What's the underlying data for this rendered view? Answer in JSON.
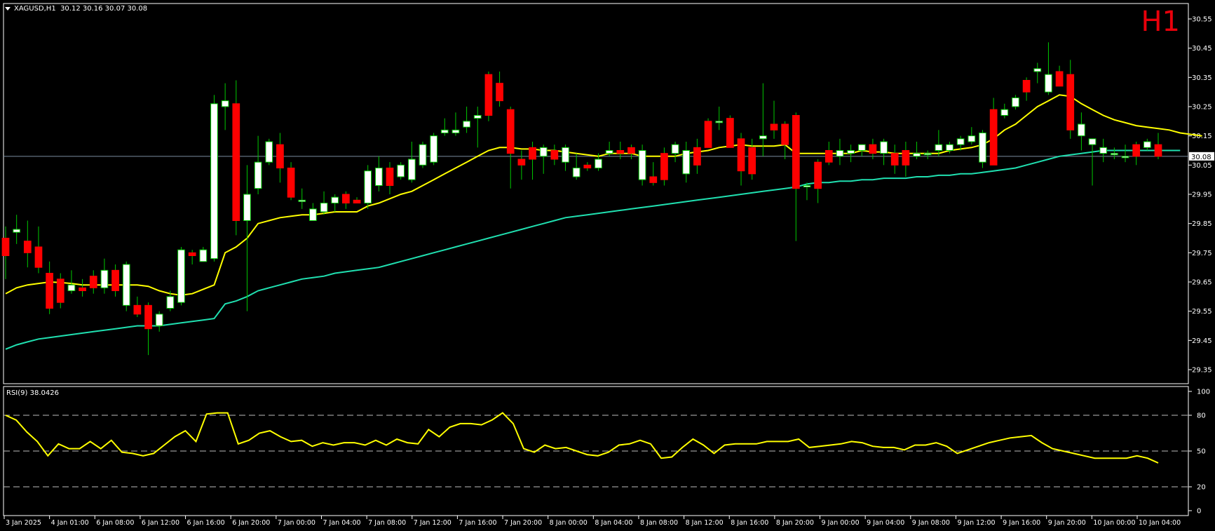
{
  "header": {
    "symbol": "XAGUSD,H1",
    "ohlc": "30.12 30.16 30.07 30.08"
  },
  "timeframe_badge": "H1",
  "current_price_label": "30.08",
  "rsi": {
    "label": "RSI(9) 38.0426"
  },
  "colors": {
    "background": "#000000",
    "bull_candle": "#ffffff",
    "bear_candle": "#ff0000",
    "wick": "#00c800",
    "ma_fast": "#ffff00",
    "ma_slow": "#20e0b0",
    "rsi_line": "#ffff00",
    "bid_line": "#7a8ca0",
    "grid_text": "#ffffff",
    "badge": "#e8000b"
  },
  "chart_data": [
    {
      "type": "candlestick",
      "symbol": "XAGUSD",
      "timeframe": "H1",
      "ylim": [
        29.3,
        30.6
      ],
      "y_ticks": [
        "30.55",
        "30.45",
        "30.35",
        "30.25",
        "30.15",
        "30.05",
        "29.95",
        "29.85",
        "29.75",
        "29.65",
        "29.55",
        "29.45",
        "29.35"
      ],
      "x_tick_labels": [
        "3 Jan 2025",
        "4 Jan 01:00",
        "6 Jan 08:00",
        "6 Jan 12:00",
        "6 Jan 16:00",
        "6 Jan 20:00",
        "7 Jan 00:00",
        "7 Jan 04:00",
        "7 Jan 08:00",
        "7 Jan 12:00",
        "7 Jan 16:00",
        "7 Jan 20:00",
        "8 Jan 00:00",
        "8 Jan 04:00",
        "8 Jan 08:00",
        "8 Jan 12:00",
        "8 Jan 16:00",
        "8 Jan 20:00",
        "9 Jan 00:00",
        "9 Jan 04:00",
        "9 Jan 08:00",
        "9 Jan 12:00",
        "9 Jan 16:00",
        "9 Jan 20:00",
        "10 Jan 00:00",
        "10 Jan 04:00"
      ],
      "candles": [
        {
          "o": 29.8,
          "h": 29.84,
          "l": 29.66,
          "c": 29.74
        },
        {
          "o": 29.82,
          "h": 29.88,
          "l": 29.78,
          "c": 29.83
        },
        {
          "o": 29.79,
          "h": 29.86,
          "l": 29.7,
          "c": 29.75
        },
        {
          "o": 29.77,
          "h": 29.84,
          "l": 29.68,
          "c": 29.7
        },
        {
          "o": 29.68,
          "h": 29.72,
          "l": 29.54,
          "c": 29.56
        },
        {
          "o": 29.66,
          "h": 29.68,
          "l": 29.56,
          "c": 29.58
        },
        {
          "o": 29.62,
          "h": 29.69,
          "l": 29.61,
          "c": 29.64
        },
        {
          "o": 29.63,
          "h": 29.66,
          "l": 29.6,
          "c": 29.62
        },
        {
          "o": 29.67,
          "h": 29.69,
          "l": 29.61,
          "c": 29.63
        },
        {
          "o": 29.63,
          "h": 29.73,
          "l": 29.61,
          "c": 29.69
        },
        {
          "o": 29.69,
          "h": 29.71,
          "l": 29.6,
          "c": 29.62
        },
        {
          "o": 29.57,
          "h": 29.72,
          "l": 29.55,
          "c": 29.71
        },
        {
          "o": 29.57,
          "h": 29.6,
          "l": 29.53,
          "c": 29.54
        },
        {
          "o": 29.57,
          "h": 29.58,
          "l": 29.4,
          "c": 29.49
        },
        {
          "o": 29.5,
          "h": 29.55,
          "l": 29.48,
          "c": 29.54
        },
        {
          "o": 29.56,
          "h": 29.62,
          "l": 29.55,
          "c": 29.6
        },
        {
          "o": 29.58,
          "h": 29.77,
          "l": 29.57,
          "c": 29.76
        },
        {
          "o": 29.75,
          "h": 29.76,
          "l": 29.71,
          "c": 29.74
        },
        {
          "o": 29.72,
          "h": 29.77,
          "l": 29.72,
          "c": 29.76
        },
        {
          "o": 29.73,
          "h": 30.29,
          "l": 29.72,
          "c": 30.26
        },
        {
          "o": 30.25,
          "h": 30.33,
          "l": 30.17,
          "c": 30.27
        },
        {
          "o": 30.26,
          "h": 30.34,
          "l": 29.81,
          "c": 29.86
        },
        {
          "o": 29.86,
          "h": 30.05,
          "l": 29.55,
          "c": 29.95
        },
        {
          "o": 29.97,
          "h": 30.15,
          "l": 29.95,
          "c": 30.06
        },
        {
          "o": 30.06,
          "h": 30.14,
          "l": 30.05,
          "c": 30.13
        },
        {
          "o": 30.12,
          "h": 30.16,
          "l": 29.99,
          "c": 30.04
        },
        {
          "o": 30.04,
          "h": 30.06,
          "l": 29.93,
          "c": 29.94
        },
        {
          "o": 29.93,
          "h": 29.97,
          "l": 29.9,
          "c": 29.93
        },
        {
          "o": 29.86,
          "h": 29.92,
          "l": 29.86,
          "c": 29.9
        },
        {
          "o": 29.89,
          "h": 29.96,
          "l": 29.88,
          "c": 29.92
        },
        {
          "o": 29.92,
          "h": 29.95,
          "l": 29.89,
          "c": 29.94
        },
        {
          "o": 29.95,
          "h": 29.96,
          "l": 29.9,
          "c": 29.92
        },
        {
          "o": 29.93,
          "h": 29.94,
          "l": 29.92,
          "c": 29.92
        },
        {
          "o": 29.92,
          "h": 30.05,
          "l": 29.9,
          "c": 30.03
        },
        {
          "o": 29.98,
          "h": 30.08,
          "l": 29.96,
          "c": 30.04
        },
        {
          "o": 30.04,
          "h": 30.06,
          "l": 29.95,
          "c": 29.98
        },
        {
          "o": 30.01,
          "h": 30.06,
          "l": 30.0,
          "c": 30.05
        },
        {
          "o": 30.0,
          "h": 30.13,
          "l": 29.99,
          "c": 30.07
        },
        {
          "o": 30.05,
          "h": 30.13,
          "l": 30.04,
          "c": 30.12
        },
        {
          "o": 30.06,
          "h": 30.16,
          "l": 30.05,
          "c": 30.15
        },
        {
          "o": 30.16,
          "h": 30.21,
          "l": 30.15,
          "c": 30.17
        },
        {
          "o": 30.16,
          "h": 30.23,
          "l": 30.15,
          "c": 30.17
        },
        {
          "o": 30.18,
          "h": 30.25,
          "l": 30.16,
          "c": 30.2
        },
        {
          "o": 30.21,
          "h": 30.25,
          "l": 30.11,
          "c": 30.22
        },
        {
          "o": 30.36,
          "h": 30.37,
          "l": 30.2,
          "c": 30.22
        },
        {
          "o": 30.33,
          "h": 30.37,
          "l": 30.25,
          "c": 30.27
        },
        {
          "o": 30.24,
          "h": 30.25,
          "l": 29.97,
          "c": 30.09
        },
        {
          "o": 30.07,
          "h": 30.1,
          "l": 30.0,
          "c": 30.05
        },
        {
          "o": 30.11,
          "h": 30.13,
          "l": 30.0,
          "c": 30.07
        },
        {
          "o": 30.08,
          "h": 30.12,
          "l": 30.02,
          "c": 30.11
        },
        {
          "o": 30.1,
          "h": 30.12,
          "l": 30.05,
          "c": 30.07
        },
        {
          "o": 30.06,
          "h": 30.12,
          "l": 30.03,
          "c": 30.11
        },
        {
          "o": 30.01,
          "h": 30.09,
          "l": 30.0,
          "c": 30.04
        },
        {
          "o": 30.05,
          "h": 30.06,
          "l": 30.03,
          "c": 30.04
        },
        {
          "o": 30.04,
          "h": 30.09,
          "l": 30.03,
          "c": 30.07
        },
        {
          "o": 30.09,
          "h": 30.13,
          "l": 30.08,
          "c": 30.1
        },
        {
          "o": 30.1,
          "h": 30.13,
          "l": 30.07,
          "c": 30.09
        },
        {
          "o": 30.11,
          "h": 30.12,
          "l": 30.07,
          "c": 30.09
        },
        {
          "o": 30.0,
          "h": 30.12,
          "l": 29.98,
          "c": 30.1
        },
        {
          "o": 30.01,
          "h": 30.06,
          "l": 29.98,
          "c": 29.99
        },
        {
          "o": 30.09,
          "h": 30.11,
          "l": 29.98,
          "c": 30.0
        },
        {
          "o": 30.09,
          "h": 30.13,
          "l": 30.06,
          "c": 30.12
        },
        {
          "o": 30.02,
          "h": 30.13,
          "l": 29.99,
          "c": 30.1
        },
        {
          "o": 30.11,
          "h": 30.14,
          "l": 30.02,
          "c": 30.05
        },
        {
          "o": 30.2,
          "h": 30.21,
          "l": 30.11,
          "c": 30.11
        },
        {
          "o": 30.2,
          "h": 30.25,
          "l": 30.17,
          "c": 30.2
        },
        {
          "o": 30.21,
          "h": 30.22,
          "l": 30.13,
          "c": 30.11
        },
        {
          "o": 30.14,
          "h": 30.16,
          "l": 29.98,
          "c": 30.03
        },
        {
          "o": 30.11,
          "h": 30.14,
          "l": 30.0,
          "c": 30.02
        },
        {
          "o": 30.14,
          "h": 30.33,
          "l": 30.08,
          "c": 30.15
        },
        {
          "o": 30.19,
          "h": 30.27,
          "l": 30.14,
          "c": 30.17
        },
        {
          "o": 30.19,
          "h": 30.2,
          "l": 30.07,
          "c": 30.12
        },
        {
          "o": 30.22,
          "h": 30.23,
          "l": 29.79,
          "c": 29.97
        },
        {
          "o": 29.98,
          "h": 29.99,
          "l": 29.93,
          "c": 29.98
        },
        {
          "o": 30.06,
          "h": 30.07,
          "l": 29.92,
          "c": 29.97
        },
        {
          "o": 30.1,
          "h": 30.13,
          "l": 30.05,
          "c": 30.06
        },
        {
          "o": 30.08,
          "h": 30.14,
          "l": 30.05,
          "c": 30.1
        },
        {
          "o": 30.09,
          "h": 30.12,
          "l": 30.06,
          "c": 30.1
        },
        {
          "o": 30.1,
          "h": 30.12,
          "l": 30.08,
          "c": 30.12
        },
        {
          "o": 30.12,
          "h": 30.14,
          "l": 30.07,
          "c": 30.09
        },
        {
          "o": 30.09,
          "h": 30.14,
          "l": 30.05,
          "c": 30.13
        },
        {
          "o": 30.09,
          "h": 30.12,
          "l": 30.02,
          "c": 30.05
        },
        {
          "o": 30.1,
          "h": 30.13,
          "l": 30.01,
          "c": 30.05
        },
        {
          "o": 30.08,
          "h": 30.13,
          "l": 30.07,
          "c": 30.09
        },
        {
          "o": 30.09,
          "h": 30.1,
          "l": 30.07,
          "c": 30.09
        },
        {
          "o": 30.1,
          "h": 30.17,
          "l": 30.08,
          "c": 30.12
        },
        {
          "o": 30.1,
          "h": 30.13,
          "l": 30.09,
          "c": 30.12
        },
        {
          "o": 30.12,
          "h": 30.15,
          "l": 30.1,
          "c": 30.14
        },
        {
          "o": 30.13,
          "h": 30.18,
          "l": 30.12,
          "c": 30.15
        },
        {
          "o": 30.06,
          "h": 30.17,
          "l": 30.04,
          "c": 30.16
        },
        {
          "o": 30.24,
          "h": 30.28,
          "l": 30.05,
          "c": 30.05
        },
        {
          "o": 30.22,
          "h": 30.26,
          "l": 30.21,
          "c": 30.24
        },
        {
          "o": 30.25,
          "h": 30.29,
          "l": 30.24,
          "c": 30.28
        },
        {
          "o": 30.34,
          "h": 30.35,
          "l": 30.27,
          "c": 30.3
        },
        {
          "o": 30.37,
          "h": 30.4,
          "l": 30.33,
          "c": 30.38
        },
        {
          "o": 30.3,
          "h": 30.47,
          "l": 30.29,
          "c": 30.36
        },
        {
          "o": 30.37,
          "h": 30.39,
          "l": 30.32,
          "c": 30.32
        },
        {
          "o": 30.36,
          "h": 30.41,
          "l": 30.14,
          "c": 30.17
        },
        {
          "o": 30.15,
          "h": 30.23,
          "l": 30.1,
          "c": 30.19
        },
        {
          "o": 30.12,
          "h": 30.14,
          "l": 29.98,
          "c": 30.14
        },
        {
          "o": 30.09,
          "h": 30.14,
          "l": 30.06,
          "c": 30.11
        },
        {
          "o": 30.09,
          "h": 30.11,
          "l": 30.07,
          "c": 30.09
        },
        {
          "o": 30.08,
          "h": 30.12,
          "l": 30.06,
          "c": 30.08
        },
        {
          "o": 30.12,
          "h": 30.13,
          "l": 30.05,
          "c": 30.08
        },
        {
          "o": 30.11,
          "h": 30.14,
          "l": 30.1,
          "c": 30.13
        },
        {
          "o": 30.12,
          "h": 30.16,
          "l": 30.07,
          "c": 30.08
        }
      ],
      "ma_fast": [
        29.61,
        29.63,
        29.64,
        29.645,
        29.65,
        29.648,
        29.645,
        29.64,
        29.64,
        29.64,
        29.64,
        29.64,
        29.64,
        29.635,
        29.62,
        29.61,
        29.605,
        29.61,
        29.625,
        29.64,
        29.75,
        29.77,
        29.8,
        29.85,
        29.86,
        29.87,
        29.875,
        29.88,
        29.88,
        29.885,
        29.89,
        29.89,
        29.89,
        29.91,
        29.92,
        29.935,
        29.95,
        29.96,
        29.98,
        30.0,
        30.02,
        30.04,
        30.06,
        30.08,
        30.1,
        30.11,
        30.11,
        30.105,
        30.105,
        30.1,
        30.1,
        30.095,
        30.09,
        30.085,
        30.08,
        30.09,
        30.09,
        30.09,
        30.08,
        30.08,
        30.08,
        30.08,
        30.09,
        30.095,
        30.1,
        30.11,
        30.115,
        30.12,
        30.115,
        30.115,
        30.115,
        30.12,
        30.09,
        30.09,
        30.09,
        30.09,
        30.09,
        30.09,
        30.1,
        30.095,
        30.095,
        30.09,
        30.09,
        30.09,
        30.09,
        30.09,
        30.1,
        30.105,
        30.11,
        30.12,
        30.14,
        30.17,
        30.19,
        30.22,
        30.25,
        30.27,
        30.29,
        30.285,
        30.26,
        30.24,
        30.22,
        30.205,
        30.195,
        30.185,
        30.18,
        30.175,
        30.17,
        30.16,
        30.155,
        30.15
      ],
      "ma_slow": [
        29.42,
        29.435,
        29.445,
        29.455,
        29.46,
        29.465,
        29.47,
        29.475,
        29.48,
        29.485,
        29.49,
        29.495,
        29.5,
        29.5,
        29.5,
        29.505,
        29.51,
        29.515,
        29.52,
        29.525,
        29.575,
        29.585,
        29.6,
        29.62,
        29.63,
        29.64,
        29.65,
        29.66,
        29.665,
        29.67,
        29.68,
        29.685,
        29.69,
        29.695,
        29.7,
        29.71,
        29.72,
        29.73,
        29.74,
        29.75,
        29.76,
        29.77,
        29.78,
        29.79,
        29.8,
        29.81,
        29.82,
        29.83,
        29.84,
        29.85,
        29.86,
        29.87,
        29.875,
        29.88,
        29.885,
        29.89,
        29.895,
        29.9,
        29.905,
        29.91,
        29.915,
        29.92,
        29.925,
        29.93,
        29.935,
        29.94,
        29.945,
        29.95,
        29.955,
        29.96,
        29.965,
        29.97,
        29.975,
        29.985,
        29.99,
        29.99,
        29.995,
        29.995,
        30.0,
        30.0,
        30.005,
        30.005,
        30.005,
        30.01,
        30.01,
        30.015,
        30.015,
        30.02,
        30.02,
        30.025,
        30.03,
        30.035,
        30.04,
        30.05,
        30.06,
        30.07,
        30.08,
        30.085,
        30.09,
        30.095,
        30.1,
        30.1,
        30.1,
        30.1,
        30.1,
        30.1,
        30.1,
        30.1
      ],
      "current_price": 30.08
    },
    {
      "type": "line",
      "name": "RSI(9)",
      "last_value": 38.0426,
      "ylim": [
        0,
        100
      ],
      "y_ticks": [
        "100",
        "80",
        "50",
        "20",
        "0"
      ],
      "levels": [
        80,
        50,
        20
      ],
      "values": [
        80,
        76,
        66,
        58,
        46,
        56,
        52,
        52,
        58,
        52,
        59,
        49,
        48,
        46,
        48,
        55,
        62,
        67,
        58,
        81,
        82,
        82,
        56,
        59,
        65,
        67,
        62,
        58,
        59,
        54,
        57,
        55,
        57,
        57,
        55,
        59,
        55,
        60,
        57,
        56,
        68,
        62,
        70,
        73,
        73,
        72,
        76,
        82,
        73,
        52,
        49,
        55,
        52,
        53,
        50,
        47,
        46,
        49,
        55,
        56,
        59,
        56,
        44,
        45,
        53,
        60,
        55,
        48,
        55,
        56,
        56,
        56,
        58,
        58,
        58,
        60,
        53,
        54,
        55,
        56,
        58,
        57,
        54,
        53,
        53,
        51,
        55,
        55,
        57,
        54,
        48,
        51,
        54,
        57,
        59,
        61,
        62,
        63,
        57,
        52,
        50,
        48,
        46,
        44,
        44,
        44,
        44,
        46,
        44,
        40
      ]
    }
  ]
}
